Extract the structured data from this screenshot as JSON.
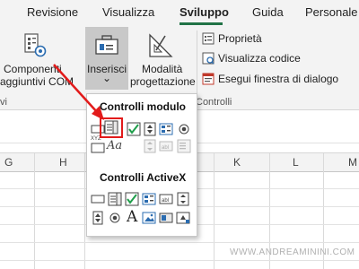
{
  "tabs": [
    "Revisione",
    "Visualizza",
    "Sviluppo",
    "Guida",
    "Personale"
  ],
  "ribbon": {
    "componenti_line1": "Componenti",
    "componenti_line2": "aggiuntivi COM",
    "inserisci": "Inserisci",
    "inserisci_caret": "⌄",
    "modalita_line1": "Modalità",
    "modalita_line2": "progettazione",
    "proprieta": "Proprietà",
    "visualizza_codice": "Visualizza codice",
    "esegui_finestra": "Esegui finestra di dialogo",
    "group_left_fragment": "vi",
    "group_controlli_fragment": "Controlli"
  },
  "columns": [
    "G",
    "H",
    "K",
    "L",
    "M"
  ],
  "dropdown": {
    "section1_title": "Controlli modulo",
    "section2_title": "Controlli ActiveX",
    "groupbox_label": "XYZ",
    "label_control": "Aa",
    "activex_label_glyph": "A"
  },
  "watermark": "WWW.ANDREAMININI.COM",
  "colors": {
    "accent": "#217346",
    "highlight": "#e21b1b",
    "arrow": "#e21b1b"
  }
}
